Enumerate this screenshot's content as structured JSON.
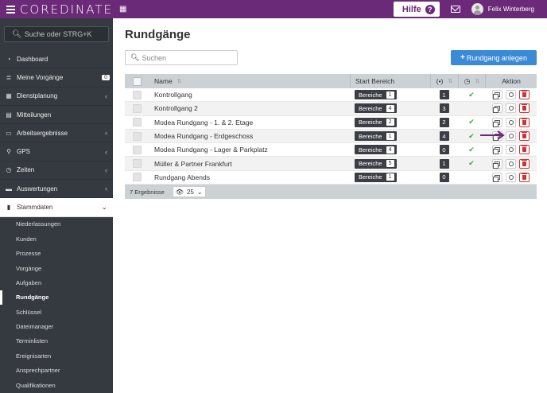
{
  "app": {
    "name": "COREDINATE"
  },
  "topbar": {
    "help_label": "Hilfe",
    "help_icon": "?",
    "user_name": "Felix Winterberg"
  },
  "sidebar": {
    "search_placeholder": "Suche oder STRG+K",
    "items": [
      {
        "label": "Dashboard",
        "icon": "dashboard-icon"
      },
      {
        "label": "Meine Vorgänge",
        "icon": "list-icon",
        "badge": "0"
      },
      {
        "label": "Dienstplanung",
        "icon": "table-icon"
      },
      {
        "label": "Mitteilungen",
        "icon": "message-icon"
      },
      {
        "label": "Arbeitsergebnisse",
        "icon": "monitor-icon"
      },
      {
        "label": "GPS",
        "icon": "map-pin-icon"
      },
      {
        "label": "Zeiten",
        "icon": "clock-icon"
      },
      {
        "label": "Auswertungen",
        "icon": "chart-icon"
      },
      {
        "label": "Stammdaten",
        "icon": "book-icon"
      }
    ],
    "sub_items": [
      "Niederlassungen",
      "Kunden",
      "Prozesse",
      "Vorgänge",
      "Aufgaben",
      "Rundgänge",
      "Schlüssel",
      "Dateimanager",
      "Terminlisten",
      "Ereignisarten",
      "Ansprechpartner",
      "Qualifikationen"
    ],
    "active_sub": "Rundgänge"
  },
  "page": {
    "title": "Rundgänge",
    "search_placeholder": "Suchen",
    "add_button": "Rundgang anlegen"
  },
  "table": {
    "headers": {
      "name": "Name",
      "start": "Start Bereich",
      "count_icon": "(•)",
      "status_icon": "clock-icon",
      "action": "Aktion"
    },
    "rows": [
      {
        "name": "Kontrollgang",
        "start": "Bereiche",
        "start_num": "1",
        "count": "1",
        "check": true
      },
      {
        "name": "Kontrollgang 2",
        "start": "Bereiche",
        "start_num": "4",
        "count": "3",
        "check": false
      },
      {
        "name": "Modea Rundgang - 1. & 2. Etage",
        "start": "Bereiche",
        "start_num": "2",
        "count": "2",
        "check": true
      },
      {
        "name": "Modea Rundgang - Erdgeschoss",
        "start": "Bereiche",
        "start_num": "1",
        "count": "4",
        "check": true
      },
      {
        "name": "Modea Rundgang - Lager & Parkplatz",
        "start": "Bereiche",
        "start_num": "4",
        "count": "0",
        "check": true
      },
      {
        "name": "Müller & Partner Frankfurt",
        "start": "Bereiche",
        "start_num": "5",
        "count": "1",
        "check": true
      },
      {
        "name": "Rundgang Abends",
        "start": "Bereiche",
        "start_num": "1",
        "count": "0",
        "check": false
      }
    ],
    "footer": {
      "results": "7 Ergebnisse",
      "page_size": "25"
    }
  },
  "colors": {
    "brand": "#6b2a78",
    "sidebar": "#343a40",
    "primary": "#3a8ad6",
    "check": "#3aa24a",
    "danger": "#cc3333"
  }
}
